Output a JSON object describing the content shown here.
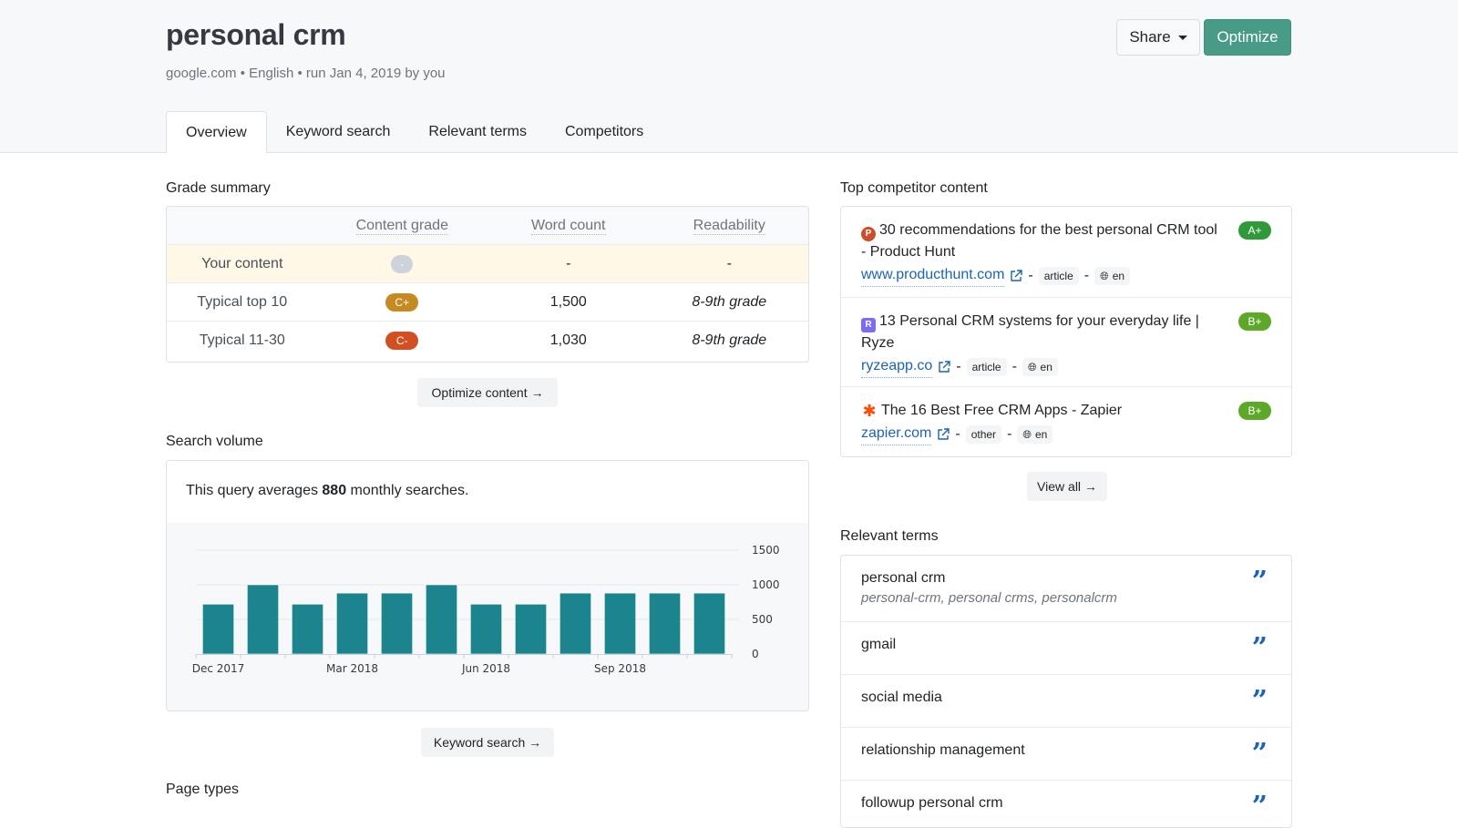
{
  "header": {
    "title": "personal crm",
    "subtitle": "google.com • English • run Jan 4, 2019 by you",
    "share_label": "Share",
    "optimize_label": "Optimize"
  },
  "tabs": [
    {
      "label": "Overview",
      "active": true
    },
    {
      "label": "Keyword search",
      "active": false
    },
    {
      "label": "Relevant terms",
      "active": false
    },
    {
      "label": "Competitors",
      "active": false
    }
  ],
  "grade_summary": {
    "title": "Grade summary",
    "columns": [
      "",
      "Content grade",
      "Word count",
      "Readability"
    ],
    "rows": [
      {
        "label": "Your content",
        "grade": "-",
        "grade_color": "#ccd3da",
        "word_count": "-",
        "readability": "-",
        "highlight": true
      },
      {
        "label": "Typical top 10",
        "grade": "C+",
        "grade_color": "#c68a22",
        "word_count": "1,500",
        "readability": "8-9th grade"
      },
      {
        "label": "Typical 11-30",
        "grade": "C-",
        "grade_color": "#d14f23",
        "word_count": "1,030",
        "readability": "8-9th grade"
      }
    ],
    "action_label": "Optimize content →"
  },
  "search_volume": {
    "title": "Search volume",
    "text_before": "This query averages ",
    "average": "880",
    "text_after": " monthly searches.",
    "action_label": "Keyword search →"
  },
  "chart_data": {
    "type": "bar",
    "title": "",
    "xlabel": "",
    "ylabel": "",
    "categories": [
      "Dec 2017",
      "Jan 2018",
      "Feb 2018",
      "Mar 2018",
      "Apr 2018",
      "May 2018",
      "Jun 2018",
      "Jul 2018",
      "Aug 2018",
      "Sep 2018",
      "Oct 2018",
      "Nov 2018"
    ],
    "values": [
      720,
      1000,
      720,
      880,
      880,
      1000,
      720,
      720,
      880,
      880,
      880,
      880
    ],
    "x_tick_labels": [
      "Dec 2017",
      "Mar 2018",
      "Jun 2018",
      "Sep 2018"
    ],
    "y_ticks": [
      0,
      500,
      1000,
      1500
    ],
    "ylim": [
      0,
      1500
    ],
    "grid": true,
    "y_axis_position": "right",
    "bar_color": "#1b848c"
  },
  "competitors": {
    "title": "Top competitor content",
    "items": [
      {
        "favicon": "P",
        "favicon_type": "ph",
        "title": "30 recommendations for the best personal CRM tool - Product Hunt",
        "domain": "www.producthunt.com",
        "type": "article",
        "lang": "en",
        "grade": "A+",
        "grade_color": "#2f9a39"
      },
      {
        "favicon": "R",
        "favicon_type": "ryze",
        "title": "13 Personal CRM systems for your everyday life | Ryze",
        "domain": "ryzeapp.co",
        "type": "article",
        "lang": "en",
        "grade": "B+",
        "grade_color": "#5ea829"
      },
      {
        "favicon": "✱",
        "favicon_type": "zap",
        "title": "The 16 Best Free CRM Apps - Zapier",
        "domain": "zapier.com",
        "type": "other",
        "lang": "en",
        "grade": "B+",
        "grade_color": "#5ea829"
      }
    ],
    "view_all_label": "View all →"
  },
  "relevant_terms": {
    "title": "Relevant terms",
    "items": [
      {
        "term": "personal crm",
        "variants": "personal-crm, personal crms, personalcrm"
      },
      {
        "term": "gmail"
      },
      {
        "term": "social media"
      },
      {
        "term": "relationship management"
      },
      {
        "term": "followup personal crm"
      }
    ]
  },
  "page_types": {
    "title": "Page types"
  }
}
